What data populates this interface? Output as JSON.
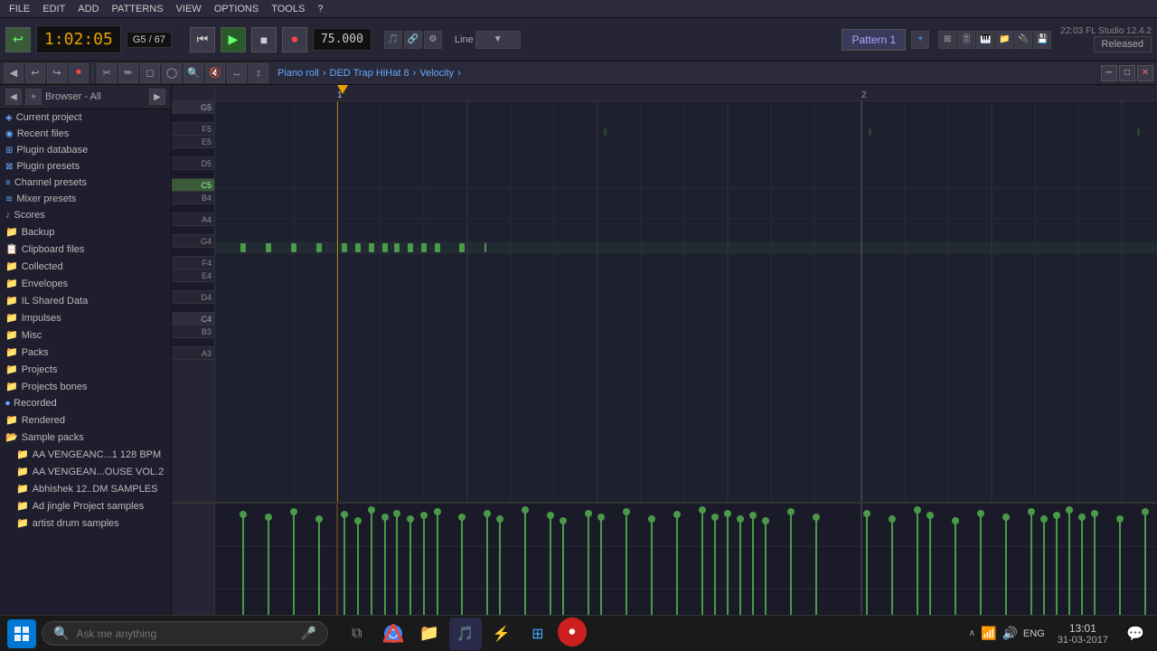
{
  "menubar": {
    "items": [
      "FILE",
      "EDIT",
      "ADD",
      "PATTERNS",
      "VIEW",
      "OPTIONS",
      "TOOLS",
      "?"
    ]
  },
  "transport": {
    "time": "1:02:05",
    "note": "G5 / 67",
    "tempo": "75.000",
    "pattern_label": "Pattern 1",
    "released": "Released",
    "version": "22:03  FL Studio 12.4.2"
  },
  "toolbar2": {
    "breadcrumb": {
      "part1": "Piano roll",
      "sep1": "›",
      "part2": "DED Trap HiHat 8",
      "sep2": "›",
      "part3": "Velocity"
    },
    "browser_label": "Browser - All"
  },
  "sidebar": {
    "items": [
      {
        "label": "Current project",
        "type": "special",
        "indent": 0
      },
      {
        "label": "Recent files",
        "type": "special",
        "indent": 0
      },
      {
        "label": "Plugin database",
        "type": "special",
        "indent": 0
      },
      {
        "label": "Plugin presets",
        "type": "special",
        "indent": 0
      },
      {
        "label": "Channel presets",
        "type": "special",
        "indent": 0
      },
      {
        "label": "Mixer presets",
        "type": "special",
        "indent": 0
      },
      {
        "label": "Scores",
        "type": "folder",
        "indent": 0
      },
      {
        "label": "Backup",
        "type": "folder",
        "indent": 0
      },
      {
        "label": "Clipboard files",
        "type": "folder",
        "indent": 0
      },
      {
        "label": "Collected",
        "type": "folder",
        "indent": 0
      },
      {
        "label": "Envelopes",
        "type": "folder",
        "indent": 0
      },
      {
        "label": "IL Shared Data",
        "type": "folder",
        "indent": 0
      },
      {
        "label": "Impulses",
        "type": "folder",
        "indent": 0
      },
      {
        "label": "Misc",
        "type": "folder",
        "indent": 0
      },
      {
        "label": "Packs",
        "type": "folder",
        "indent": 0
      },
      {
        "label": "Projects",
        "type": "folder",
        "indent": 0
      },
      {
        "label": "Projects bones",
        "type": "folder",
        "indent": 0
      },
      {
        "label": "Recorded",
        "type": "special2",
        "indent": 0
      },
      {
        "label": "Rendered",
        "type": "folder",
        "indent": 0
      },
      {
        "label": "Sample packs",
        "type": "folder",
        "indent": 0,
        "open": true
      },
      {
        "label": "AA VENGEANC...1 128 BPM",
        "type": "subfolder",
        "indent": 1
      },
      {
        "label": "AA VENGEAN...OUSE VOL.2",
        "type": "subfolder",
        "indent": 1
      },
      {
        "label": "Abhishek 12..DM SAMPLES",
        "type": "subfolder",
        "indent": 1
      },
      {
        "label": "Ad jingle Project samples",
        "type": "subfolder",
        "indent": 1
      },
      {
        "label": "artist drum samples",
        "type": "subfolder",
        "indent": 1
      }
    ]
  },
  "piano_keys": [
    {
      "label": "G5",
      "type": "white"
    },
    {
      "label": "",
      "type": "black"
    },
    {
      "label": "F5",
      "type": "white"
    },
    {
      "label": "E5",
      "type": "white"
    },
    {
      "label": "",
      "type": "black"
    },
    {
      "label": "D5",
      "type": "white"
    },
    {
      "label": "",
      "type": "black"
    },
    {
      "label": "C5",
      "type": "white"
    },
    {
      "label": "B4",
      "type": "white"
    },
    {
      "label": "",
      "type": "black"
    },
    {
      "label": "A4",
      "type": "white"
    },
    {
      "label": "",
      "type": "black"
    },
    {
      "label": "G4",
      "type": "white"
    },
    {
      "label": "",
      "type": "black"
    },
    {
      "label": "F4",
      "type": "white"
    },
    {
      "label": "E4",
      "type": "white"
    },
    {
      "label": "",
      "type": "black"
    },
    {
      "label": "D4",
      "type": "white"
    },
    {
      "label": "",
      "type": "black"
    },
    {
      "label": "C4",
      "type": "white"
    },
    {
      "label": "B3",
      "type": "white"
    },
    {
      "label": "",
      "type": "black"
    },
    {
      "label": "A3",
      "type": "white"
    }
  ],
  "taskbar": {
    "search_placeholder": "Ask me anything",
    "time": "13:01",
    "date": "31-03-2017",
    "lang": "ENG"
  },
  "colors": {
    "accent": "#4a9a4a",
    "playhead": "#e8a000",
    "background": "#1e2030",
    "sidebar_bg": "#1e1e2e"
  }
}
